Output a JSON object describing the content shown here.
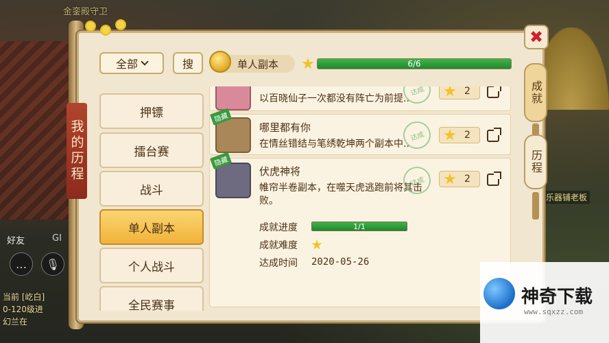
{
  "background": {
    "guard_label": "金銮殿守卫",
    "npc_label": "乐器铺老板",
    "hud_friend": "好友",
    "hud_g": "GI",
    "chat_lines": [
      "当前 [屹白]",
      "0-120级进",
      "幻兰在"
    ]
  },
  "panel": {
    "title": "我的历程",
    "filter_label": "全部",
    "search_label": "搜",
    "category_badge": "单人副本",
    "progress_text": "6/6",
    "progress": 1.0,
    "close_label": "✖"
  },
  "right_tabs": [
    {
      "label": "成就",
      "active": true
    },
    {
      "label": "历程",
      "active": false
    }
  ],
  "categories": [
    {
      "label": "押镖",
      "active": false
    },
    {
      "label": "擂台赛",
      "active": false
    },
    {
      "label": "战斗",
      "active": false
    },
    {
      "label": "单人副本",
      "active": true
    },
    {
      "label": "个人战斗",
      "active": false
    },
    {
      "label": "全民赛事",
      "active": false
    }
  ],
  "entries": [
    {
      "name": "",
      "desc": "以百晓仙子一次都没有阵亡为前提..",
      "stamp": "达成",
      "points": "2",
      "hidden_tag": ""
    },
    {
      "name": "哪里都有你",
      "desc": "在情丝错结与笔绣乾坤两个副本中..",
      "stamp": "达成",
      "points": "2",
      "hidden_tag": "隐藏"
    },
    {
      "name": "伏虎神将",
      "desc": "帷帘半卷副本，在噬天虎逃跑前将其击败。",
      "stamp": "达成",
      "points": "2",
      "hidden_tag": "隐藏",
      "detail": {
        "progress_label": "成就进度",
        "progress_text": "1/1",
        "progress": 1.0,
        "difficulty_label": "成就难度",
        "difficulty_stars": 1,
        "date_label": "达成时间",
        "date": "2020-05-26"
      }
    }
  ],
  "watermark": {
    "title": "神奇下载",
    "url": "www.sqxzz.com"
  }
}
